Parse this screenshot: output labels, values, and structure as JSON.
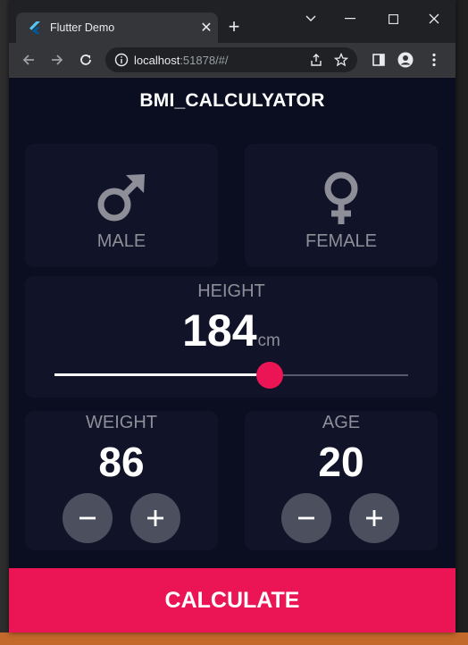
{
  "browser": {
    "tab_title": "Flutter Demo",
    "url_host": "localhost",
    "url_path": ":51878/#/"
  },
  "app": {
    "title": "BMI_CALCULYATOR",
    "gender": {
      "male_label": "MALE",
      "female_label": "FEMALE"
    },
    "height": {
      "label": "HEIGHT",
      "value": "184",
      "unit": "cm",
      "slider_fraction": 0.608
    },
    "weight": {
      "label": "WEIGHT",
      "value": "86"
    },
    "age": {
      "label": "AGE",
      "value": "20"
    },
    "calculate_label": "CALCULATE"
  },
  "colors": {
    "background": "#0b0e21",
    "card": "#111428",
    "accent": "#eb1555",
    "label": "#8d8e98",
    "round_button": "#4c4f5e"
  },
  "icons": [
    "flutter-favicon-icon",
    "close-icon",
    "new-tab-icon",
    "chevron-down-icon",
    "minimize-icon",
    "maximize-icon",
    "window-close-icon",
    "back-icon",
    "forward-icon",
    "reload-icon",
    "site-info-icon",
    "share-icon",
    "bookmark-star-icon",
    "side-panel-icon",
    "profile-icon",
    "menu-icon",
    "male-icon",
    "female-icon",
    "minus-icon",
    "plus-icon"
  ]
}
